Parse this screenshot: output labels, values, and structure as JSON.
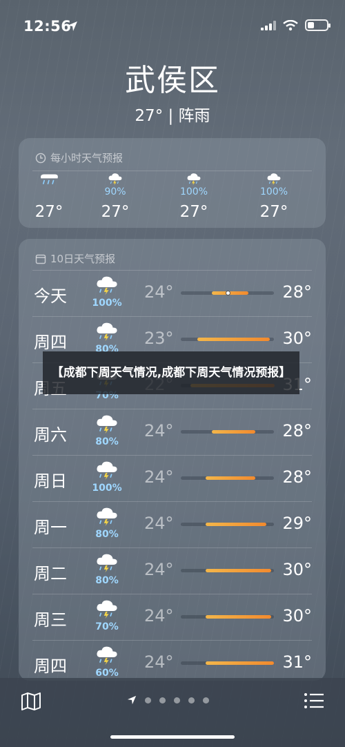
{
  "status_bar": {
    "time": "12:56"
  },
  "header": {
    "city": "武侯区",
    "condition": "27° | 阵雨"
  },
  "hourly": {
    "title": "每小时天气预报",
    "items": [
      {
        "pct": "",
        "temp": "27°",
        "icon": "heavy-rain-icon"
      },
      {
        "pct": "90%",
        "temp": "27°",
        "icon": "thunderstorm-icon"
      },
      {
        "pct": "100%",
        "temp": "27°",
        "icon": "thunderstorm-icon"
      },
      {
        "pct": "100%",
        "temp": "27°",
        "icon": "thunderstorm-icon"
      }
    ]
  },
  "daily": {
    "title": "10日天气预报",
    "days": [
      {
        "day": "今天",
        "pct": "100%",
        "low": "24°",
        "high": "28°",
        "range": [
          0.33,
          0.72
        ],
        "current": 0.5,
        "icon": "thunderstorm-icon"
      },
      {
        "day": "周四",
        "pct": "80%",
        "low": "23°",
        "high": "30°",
        "range": [
          0.18,
          0.96
        ],
        "icon": "thunderstorm-icon"
      },
      {
        "day": "周五",
        "pct": "70%",
        "low": "22°",
        "high": "31°",
        "range": [
          0.1,
          1.0
        ],
        "icon": "thunderstorm-icon"
      },
      {
        "day": "周六",
        "pct": "80%",
        "low": "24°",
        "high": "28°",
        "range": [
          0.33,
          0.8
        ],
        "icon": "thunderstorm-icon"
      },
      {
        "day": "周日",
        "pct": "100%",
        "low": "24°",
        "high": "28°",
        "range": [
          0.27,
          0.8
        ],
        "icon": "thunderstorm-icon"
      },
      {
        "day": "周一",
        "pct": "80%",
        "low": "24°",
        "high": "29°",
        "range": [
          0.27,
          0.92
        ],
        "icon": "thunderstorm-icon"
      },
      {
        "day": "周二",
        "pct": "80%",
        "low": "24°",
        "high": "30°",
        "range": [
          0.27,
          0.97
        ],
        "icon": "thunderstorm-icon"
      },
      {
        "day": "周三",
        "pct": "70%",
        "low": "24°",
        "high": "30°",
        "range": [
          0.27,
          0.97
        ],
        "icon": "thunderstorm-icon"
      },
      {
        "day": "周四",
        "pct": "60%",
        "low": "24°",
        "high": "31°",
        "range": [
          0.27,
          1.0
        ],
        "icon": "thunderstorm-icon"
      }
    ]
  },
  "overlay": {
    "text": "【成都下周天气情况,成都下周天气情况预报】"
  },
  "bottom": {
    "page_count": 5
  }
}
